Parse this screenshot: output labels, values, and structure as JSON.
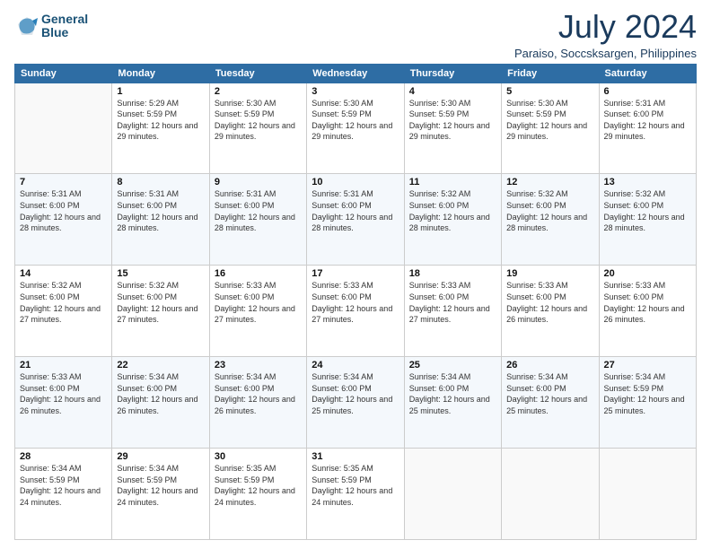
{
  "header": {
    "logo_line1": "General",
    "logo_line2": "Blue",
    "month_year": "July 2024",
    "location": "Paraiso, Soccsksargen, Philippines"
  },
  "days_of_week": [
    "Sunday",
    "Monday",
    "Tuesday",
    "Wednesday",
    "Thursday",
    "Friday",
    "Saturday"
  ],
  "weeks": [
    [
      {
        "day": "",
        "empty": true
      },
      {
        "day": "1",
        "sunrise": "5:29 AM",
        "sunset": "5:59 PM",
        "daylight": "12 hours and 29 minutes."
      },
      {
        "day": "2",
        "sunrise": "5:30 AM",
        "sunset": "5:59 PM",
        "daylight": "12 hours and 29 minutes."
      },
      {
        "day": "3",
        "sunrise": "5:30 AM",
        "sunset": "5:59 PM",
        "daylight": "12 hours and 29 minutes."
      },
      {
        "day": "4",
        "sunrise": "5:30 AM",
        "sunset": "5:59 PM",
        "daylight": "12 hours and 29 minutes."
      },
      {
        "day": "5",
        "sunrise": "5:30 AM",
        "sunset": "5:59 PM",
        "daylight": "12 hours and 29 minutes."
      },
      {
        "day": "6",
        "sunrise": "5:31 AM",
        "sunset": "6:00 PM",
        "daylight": "12 hours and 29 minutes."
      }
    ],
    [
      {
        "day": "7",
        "sunrise": "5:31 AM",
        "sunset": "6:00 PM",
        "daylight": "12 hours and 28 minutes."
      },
      {
        "day": "8",
        "sunrise": "5:31 AM",
        "sunset": "6:00 PM",
        "daylight": "12 hours and 28 minutes."
      },
      {
        "day": "9",
        "sunrise": "5:31 AM",
        "sunset": "6:00 PM",
        "daylight": "12 hours and 28 minutes."
      },
      {
        "day": "10",
        "sunrise": "5:31 AM",
        "sunset": "6:00 PM",
        "daylight": "12 hours and 28 minutes."
      },
      {
        "day": "11",
        "sunrise": "5:32 AM",
        "sunset": "6:00 PM",
        "daylight": "12 hours and 28 minutes."
      },
      {
        "day": "12",
        "sunrise": "5:32 AM",
        "sunset": "6:00 PM",
        "daylight": "12 hours and 28 minutes."
      },
      {
        "day": "13",
        "sunrise": "5:32 AM",
        "sunset": "6:00 PM",
        "daylight": "12 hours and 28 minutes."
      }
    ],
    [
      {
        "day": "14",
        "sunrise": "5:32 AM",
        "sunset": "6:00 PM",
        "daylight": "12 hours and 27 minutes."
      },
      {
        "day": "15",
        "sunrise": "5:32 AM",
        "sunset": "6:00 PM",
        "daylight": "12 hours and 27 minutes."
      },
      {
        "day": "16",
        "sunrise": "5:33 AM",
        "sunset": "6:00 PM",
        "daylight": "12 hours and 27 minutes."
      },
      {
        "day": "17",
        "sunrise": "5:33 AM",
        "sunset": "6:00 PM",
        "daylight": "12 hours and 27 minutes."
      },
      {
        "day": "18",
        "sunrise": "5:33 AM",
        "sunset": "6:00 PM",
        "daylight": "12 hours and 27 minutes."
      },
      {
        "day": "19",
        "sunrise": "5:33 AM",
        "sunset": "6:00 PM",
        "daylight": "12 hours and 26 minutes."
      },
      {
        "day": "20",
        "sunrise": "5:33 AM",
        "sunset": "6:00 PM",
        "daylight": "12 hours and 26 minutes."
      }
    ],
    [
      {
        "day": "21",
        "sunrise": "5:33 AM",
        "sunset": "6:00 PM",
        "daylight": "12 hours and 26 minutes."
      },
      {
        "day": "22",
        "sunrise": "5:34 AM",
        "sunset": "6:00 PM",
        "daylight": "12 hours and 26 minutes."
      },
      {
        "day": "23",
        "sunrise": "5:34 AM",
        "sunset": "6:00 PM",
        "daylight": "12 hours and 26 minutes."
      },
      {
        "day": "24",
        "sunrise": "5:34 AM",
        "sunset": "6:00 PM",
        "daylight": "12 hours and 25 minutes."
      },
      {
        "day": "25",
        "sunrise": "5:34 AM",
        "sunset": "6:00 PM",
        "daylight": "12 hours and 25 minutes."
      },
      {
        "day": "26",
        "sunrise": "5:34 AM",
        "sunset": "6:00 PM",
        "daylight": "12 hours and 25 minutes."
      },
      {
        "day": "27",
        "sunrise": "5:34 AM",
        "sunset": "5:59 PM",
        "daylight": "12 hours and 25 minutes."
      }
    ],
    [
      {
        "day": "28",
        "sunrise": "5:34 AM",
        "sunset": "5:59 PM",
        "daylight": "12 hours and 24 minutes."
      },
      {
        "day": "29",
        "sunrise": "5:34 AM",
        "sunset": "5:59 PM",
        "daylight": "12 hours and 24 minutes."
      },
      {
        "day": "30",
        "sunrise": "5:35 AM",
        "sunset": "5:59 PM",
        "daylight": "12 hours and 24 minutes."
      },
      {
        "day": "31",
        "sunrise": "5:35 AM",
        "sunset": "5:59 PM",
        "daylight": "12 hours and 24 minutes."
      },
      {
        "day": "",
        "empty": true
      },
      {
        "day": "",
        "empty": true
      },
      {
        "day": "",
        "empty": true
      }
    ]
  ]
}
